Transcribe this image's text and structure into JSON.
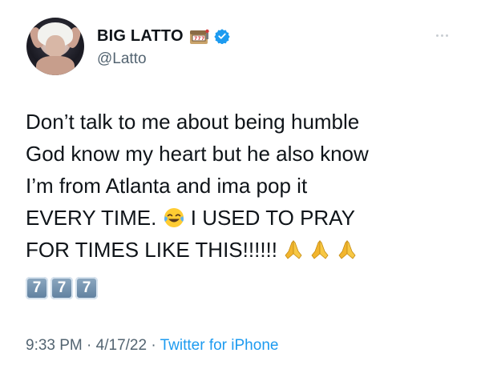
{
  "user": {
    "display_name": "BIG LATTO",
    "handle": "@Latto",
    "badges": [
      "slot-machine-emoji",
      "verified-badge"
    ],
    "verified_color": "#1d9bf0"
  },
  "tweet": {
    "lines": [
      "Don’t talk to me about being humble",
      "God know my heart but he also know",
      "I’m from Atlanta and ima pop it",
      "EVERY TIME.",
      "I USED TO PRAY",
      "FOR TIMES LIKE THIS!!!!!!"
    ],
    "emojis": {
      "laugh": "tears-of-joy-emoji",
      "pray": "folded-hands-emoji",
      "keycaps": [
        "7",
        "7",
        "7"
      ]
    }
  },
  "meta": {
    "time": "9:33 PM",
    "separator": "·",
    "date": "4/17/22",
    "source": "Twitter for iPhone",
    "link_color": "#1d9bf0"
  }
}
